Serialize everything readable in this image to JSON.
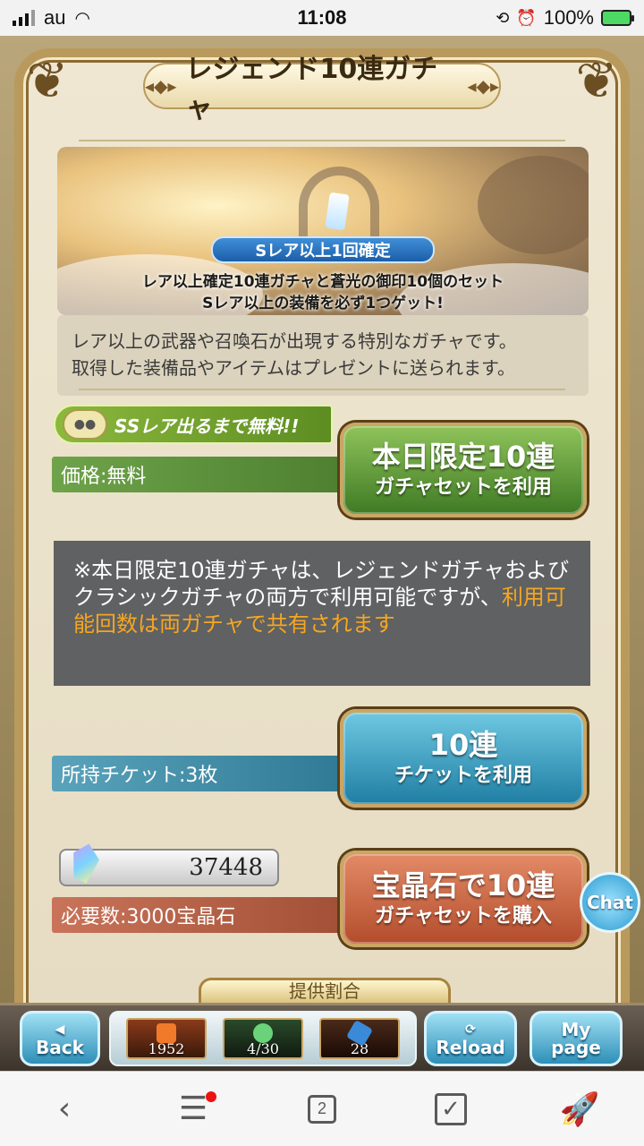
{
  "status_bar": {
    "carrier": "au",
    "time": "11:08",
    "battery_percent": "100%"
  },
  "title": "レジェンド10連ガチャ",
  "banner": {
    "tag": "Sレア以上1回確定",
    "line1": "レア以上確定10連ガチャと蒼光の御印10個のセット",
    "line2": "Sレア以上の装備を必ず1つゲット!"
  },
  "description": {
    "line1": "レア以上の武器や召喚石が出現する特別なガチャです。",
    "line2": "取得した装備品やアイテムはプレゼントに送られます。"
  },
  "free_badge": {
    "text": "SSレア出るまで無料!!"
  },
  "daily_row": {
    "price_label": "価格:無料",
    "button_line1": "本日限定10連",
    "button_line2": "ガチャセットを利用"
  },
  "note": {
    "text_normal": "※本日限定10連ガチャは、レジェンドガチャおよびクラシックガチャの両方で利用可能ですが、",
    "text_highlight": "利用可能回数は両ガチャで共有されます"
  },
  "ticket_row": {
    "label": "所持チケット:3枚",
    "button_line1": "10連",
    "button_line2": "チケットを利用"
  },
  "crystal_row": {
    "balance": "37448",
    "required_label": "必要数:3000宝晶石",
    "button_line1": "宝晶石で10連",
    "button_line2": "ガチャセットを購入"
  },
  "chat_label": "Chat",
  "peek_button_text": "提供割合",
  "game_bar": {
    "back_label": "Back",
    "reload_label": "Reload",
    "mypage_line1": "My",
    "mypage_line2": "page",
    "items": [
      {
        "value": "1952",
        "color": "#c8501e"
      },
      {
        "value": "4/30",
        "color": "#3a6e3a"
      },
      {
        "value": "28",
        "color": "#3b2a1a"
      }
    ]
  },
  "browser_bar": {
    "tab_count": "2",
    "icons": [
      "back-chevron-icon",
      "menu-icon",
      "tabs-icon",
      "checkbox-icon",
      "rocket-icon"
    ]
  }
}
